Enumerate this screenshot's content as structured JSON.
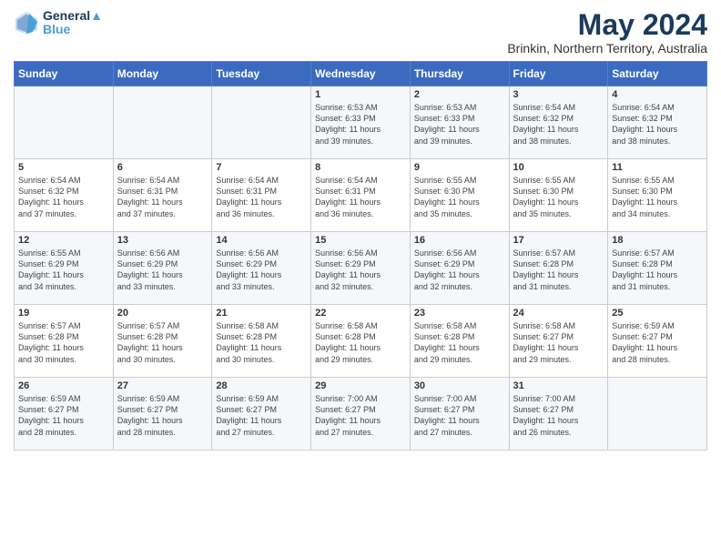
{
  "header": {
    "logo_line1": "General",
    "logo_line2": "Blue",
    "title": "May 2024",
    "subtitle": "Brinkin, Northern Territory, Australia"
  },
  "weekdays": [
    "Sunday",
    "Monday",
    "Tuesday",
    "Wednesday",
    "Thursday",
    "Friday",
    "Saturday"
  ],
  "weeks": [
    [
      {
        "day": "",
        "lines": []
      },
      {
        "day": "",
        "lines": []
      },
      {
        "day": "",
        "lines": []
      },
      {
        "day": "1",
        "lines": [
          "Sunrise: 6:53 AM",
          "Sunset: 6:33 PM",
          "Daylight: 11 hours",
          "and 39 minutes."
        ]
      },
      {
        "day": "2",
        "lines": [
          "Sunrise: 6:53 AM",
          "Sunset: 6:33 PM",
          "Daylight: 11 hours",
          "and 39 minutes."
        ]
      },
      {
        "day": "3",
        "lines": [
          "Sunrise: 6:54 AM",
          "Sunset: 6:32 PM",
          "Daylight: 11 hours",
          "and 38 minutes."
        ]
      },
      {
        "day": "4",
        "lines": [
          "Sunrise: 6:54 AM",
          "Sunset: 6:32 PM",
          "Daylight: 11 hours",
          "and 38 minutes."
        ]
      }
    ],
    [
      {
        "day": "5",
        "lines": [
          "Sunrise: 6:54 AM",
          "Sunset: 6:32 PM",
          "Daylight: 11 hours",
          "and 37 minutes."
        ]
      },
      {
        "day": "6",
        "lines": [
          "Sunrise: 6:54 AM",
          "Sunset: 6:31 PM",
          "Daylight: 11 hours",
          "and 37 minutes."
        ]
      },
      {
        "day": "7",
        "lines": [
          "Sunrise: 6:54 AM",
          "Sunset: 6:31 PM",
          "Daylight: 11 hours",
          "and 36 minutes."
        ]
      },
      {
        "day": "8",
        "lines": [
          "Sunrise: 6:54 AM",
          "Sunset: 6:31 PM",
          "Daylight: 11 hours",
          "and 36 minutes."
        ]
      },
      {
        "day": "9",
        "lines": [
          "Sunrise: 6:55 AM",
          "Sunset: 6:30 PM",
          "Daylight: 11 hours",
          "and 35 minutes."
        ]
      },
      {
        "day": "10",
        "lines": [
          "Sunrise: 6:55 AM",
          "Sunset: 6:30 PM",
          "Daylight: 11 hours",
          "and 35 minutes."
        ]
      },
      {
        "day": "11",
        "lines": [
          "Sunrise: 6:55 AM",
          "Sunset: 6:30 PM",
          "Daylight: 11 hours",
          "and 34 minutes."
        ]
      }
    ],
    [
      {
        "day": "12",
        "lines": [
          "Sunrise: 6:55 AM",
          "Sunset: 6:29 PM",
          "Daylight: 11 hours",
          "and 34 minutes."
        ]
      },
      {
        "day": "13",
        "lines": [
          "Sunrise: 6:56 AM",
          "Sunset: 6:29 PM",
          "Daylight: 11 hours",
          "and 33 minutes."
        ]
      },
      {
        "day": "14",
        "lines": [
          "Sunrise: 6:56 AM",
          "Sunset: 6:29 PM",
          "Daylight: 11 hours",
          "and 33 minutes."
        ]
      },
      {
        "day": "15",
        "lines": [
          "Sunrise: 6:56 AM",
          "Sunset: 6:29 PM",
          "Daylight: 11 hours",
          "and 32 minutes."
        ]
      },
      {
        "day": "16",
        "lines": [
          "Sunrise: 6:56 AM",
          "Sunset: 6:29 PM",
          "Daylight: 11 hours",
          "and 32 minutes."
        ]
      },
      {
        "day": "17",
        "lines": [
          "Sunrise: 6:57 AM",
          "Sunset: 6:28 PM",
          "Daylight: 11 hours",
          "and 31 minutes."
        ]
      },
      {
        "day": "18",
        "lines": [
          "Sunrise: 6:57 AM",
          "Sunset: 6:28 PM",
          "Daylight: 11 hours",
          "and 31 minutes."
        ]
      }
    ],
    [
      {
        "day": "19",
        "lines": [
          "Sunrise: 6:57 AM",
          "Sunset: 6:28 PM",
          "Daylight: 11 hours",
          "and 30 minutes."
        ]
      },
      {
        "day": "20",
        "lines": [
          "Sunrise: 6:57 AM",
          "Sunset: 6:28 PM",
          "Daylight: 11 hours",
          "and 30 minutes."
        ]
      },
      {
        "day": "21",
        "lines": [
          "Sunrise: 6:58 AM",
          "Sunset: 6:28 PM",
          "Daylight: 11 hours",
          "and 30 minutes."
        ]
      },
      {
        "day": "22",
        "lines": [
          "Sunrise: 6:58 AM",
          "Sunset: 6:28 PM",
          "Daylight: 11 hours",
          "and 29 minutes."
        ]
      },
      {
        "day": "23",
        "lines": [
          "Sunrise: 6:58 AM",
          "Sunset: 6:28 PM",
          "Daylight: 11 hours",
          "and 29 minutes."
        ]
      },
      {
        "day": "24",
        "lines": [
          "Sunrise: 6:58 AM",
          "Sunset: 6:27 PM",
          "Daylight: 11 hours",
          "and 29 minutes."
        ]
      },
      {
        "day": "25",
        "lines": [
          "Sunrise: 6:59 AM",
          "Sunset: 6:27 PM",
          "Daylight: 11 hours",
          "and 28 minutes."
        ]
      }
    ],
    [
      {
        "day": "26",
        "lines": [
          "Sunrise: 6:59 AM",
          "Sunset: 6:27 PM",
          "Daylight: 11 hours",
          "and 28 minutes."
        ]
      },
      {
        "day": "27",
        "lines": [
          "Sunrise: 6:59 AM",
          "Sunset: 6:27 PM",
          "Daylight: 11 hours",
          "and 28 minutes."
        ]
      },
      {
        "day": "28",
        "lines": [
          "Sunrise: 6:59 AM",
          "Sunset: 6:27 PM",
          "Daylight: 11 hours",
          "and 27 minutes."
        ]
      },
      {
        "day": "29",
        "lines": [
          "Sunrise: 7:00 AM",
          "Sunset: 6:27 PM",
          "Daylight: 11 hours",
          "and 27 minutes."
        ]
      },
      {
        "day": "30",
        "lines": [
          "Sunrise: 7:00 AM",
          "Sunset: 6:27 PM",
          "Daylight: 11 hours",
          "and 27 minutes."
        ]
      },
      {
        "day": "31",
        "lines": [
          "Sunrise: 7:00 AM",
          "Sunset: 6:27 PM",
          "Daylight: 11 hours",
          "and 26 minutes."
        ]
      },
      {
        "day": "",
        "lines": []
      }
    ]
  ]
}
